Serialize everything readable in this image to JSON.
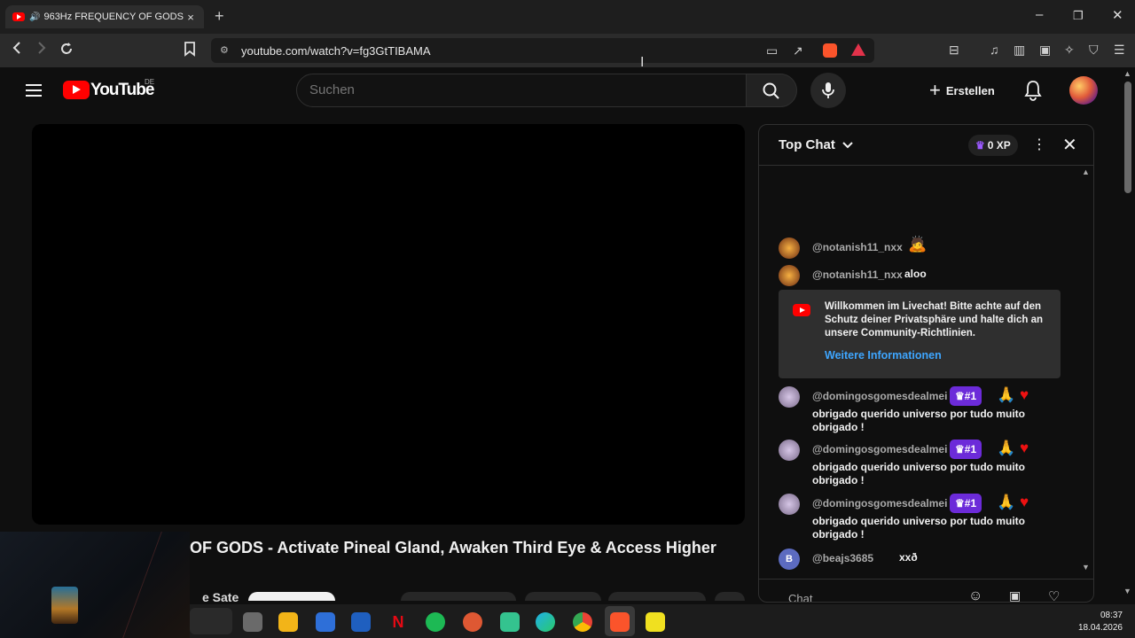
{
  "browser": {
    "tab_title": "963Hz FREQUENCY OF GODS",
    "tab_close": "×",
    "new_tab": "+",
    "url": "youtube.com/watch?v=fg3GtTIBAMA",
    "win_min": "–",
    "win_max": "❐",
    "win_close": "✕"
  },
  "youtube": {
    "logo_text": "YouTube",
    "country": "DE",
    "search_placeholder": "Suchen",
    "create_label": "Erstellen"
  },
  "video": {
    "title": "OF GODS - Activate Pineal Gland, Awaken Third Eye & Access Higher",
    "channel_fragment": "e Sate"
  },
  "chat": {
    "header": "Top Chat",
    "xp": "0 XP",
    "input_placeholder": "Chat",
    "messages": [
      {
        "author": "@notanish11_nxx",
        "text": "🙇"
      },
      {
        "author": "@notanish11_nxx",
        "text": "aloo"
      },
      {
        "author": "@domingosgomesdealmei",
        "badge": "#1",
        "emoji": "🙏",
        "text": "obrigado querido universo por tudo muito obrigado !"
      },
      {
        "author": "@domingosgomesdealmei",
        "badge": "#1",
        "emoji": "🙏",
        "text": "obrigado querido universo por tudo muito obrigado !"
      },
      {
        "author": "@domingosgomesdealmei",
        "badge": "#1",
        "emoji": "🙏",
        "text": "obrigado querido universo por tudo muito obrigado !"
      },
      {
        "author": "@beajs3685",
        "text": "xxð",
        "avatar_letter": "B"
      }
    ],
    "notice": {
      "text": "Willkommen im Livechat! Bitte achte auf den Schutz deiner Privatsphäre und halte dich an unsere Community-Richtlinien.",
      "link": "Weitere Informationen"
    }
  },
  "taskbar": {
    "time": "08:37",
    "date": "18.04.2026"
  },
  "colors": {
    "accent_red": "#ff0000",
    "link_blue": "#3ea6ff",
    "badge_purple": "#6c2bd9"
  }
}
